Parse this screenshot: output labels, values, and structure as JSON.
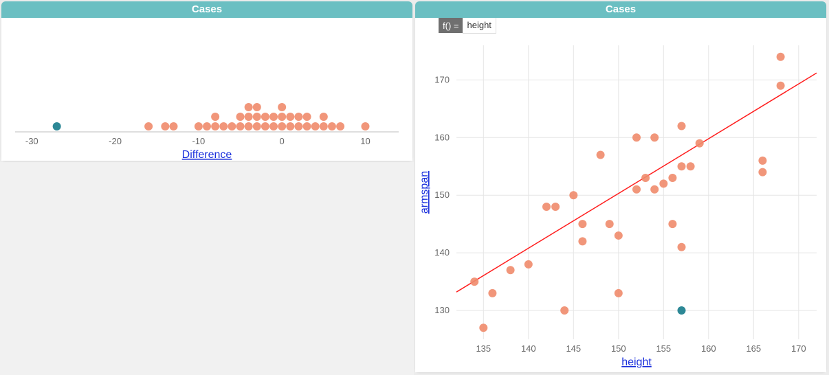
{
  "colors": {
    "header": "#6bbfc2",
    "point": "#f08b6c",
    "selected_point": "#2d8896",
    "fit_line": "#ff1f1f",
    "axis_label": "#1a2fdc"
  },
  "left_panel": {
    "title": "Cases",
    "x_axis_label": "Difference"
  },
  "right_panel": {
    "title": "Cases",
    "formula_prefix": "f() =",
    "formula_expr": "height",
    "x_axis_label": "height",
    "y_axis_label": "armspan"
  },
  "chart_data": [
    {
      "id": "dotplot",
      "type": "dotplot",
      "title": "Cases",
      "xlabel": "Difference",
      "xlim": [
        -32,
        14
      ],
      "xticks": [
        -30,
        -20,
        -10,
        0,
        10
      ],
      "series": [
        {
          "name": "cases",
          "values": [
            -27,
            -16,
            -14,
            -13,
            -10,
            -9,
            -8,
            -8,
            -7,
            -6,
            -5,
            -5,
            -4,
            -4,
            -4,
            -3,
            -3,
            -3,
            -2,
            -2,
            -1,
            -1,
            0,
            0,
            0,
            1,
            1,
            2,
            2,
            3,
            3,
            4,
            5,
            5,
            6,
            7,
            10
          ]
        }
      ],
      "selected_values": [
        -27
      ]
    },
    {
      "id": "scatter",
      "type": "scatter",
      "title": "Cases",
      "xlabel": "height",
      "ylabel": "armspan",
      "xlim": [
        132,
        172
      ],
      "ylim": [
        125,
        176
      ],
      "xticks": [
        135,
        140,
        145,
        150,
        155,
        160,
        165,
        170
      ],
      "yticks": [
        130,
        140,
        150,
        160,
        170
      ],
      "fit": {
        "type": "linear",
        "slope": 0.95,
        "intercept": 7.8
      },
      "series": [
        {
          "name": "cases",
          "points": [
            [
              134,
              135
            ],
            [
              135,
              127
            ],
            [
              136,
              133
            ],
            [
              138,
              137
            ],
            [
              140,
              138
            ],
            [
              142,
              148
            ],
            [
              143,
              148
            ],
            [
              144,
              130
            ],
            [
              145,
              150
            ],
            [
              146,
              142
            ],
            [
              146,
              145
            ],
            [
              148,
              157
            ],
            [
              149,
              145
            ],
            [
              150,
              143
            ],
            [
              150,
              133
            ],
            [
              152,
              160
            ],
            [
              152,
              151
            ],
            [
              153,
              153
            ],
            [
              154,
              160
            ],
            [
              154,
              151
            ],
            [
              155,
              152
            ],
            [
              156,
              153
            ],
            [
              156,
              145
            ],
            [
              157,
              162
            ],
            [
              157,
              155
            ],
            [
              157,
              141
            ],
            [
              158,
              155
            ],
            [
              159,
              159
            ],
            [
              166,
              156
            ],
            [
              166,
              154
            ],
            [
              168,
              174
            ],
            [
              168,
              169
            ]
          ]
        }
      ],
      "selected_points": [
        [
          157,
          130
        ]
      ]
    }
  ]
}
